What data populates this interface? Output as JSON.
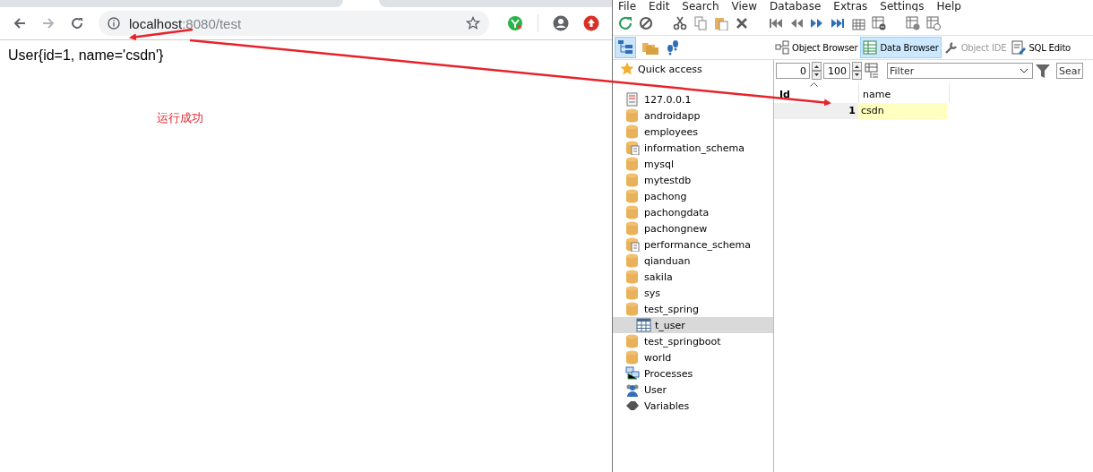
{
  "browser": {
    "url_host": "localhost",
    "url_path": ":8080/test",
    "body_text": "User{id=1, name='csdn'}",
    "note": "运行成功"
  },
  "sqlyog": {
    "menu": [
      "File",
      "Edit",
      "Search",
      "View",
      "Database",
      "Extras",
      "Settings",
      "Help"
    ],
    "view_tabs": [
      {
        "label": "Object Browser",
        "selected": false,
        "disabled": false
      },
      {
        "label": "Data Browser",
        "selected": true,
        "disabled": false
      },
      {
        "label": "Object IDE",
        "selected": false,
        "disabled": true
      },
      {
        "label": "SQL Edito",
        "selected": false,
        "disabled": false
      }
    ],
    "quick_access": "Quick access",
    "limit_start": "0",
    "limit_count": "100",
    "filter_placeholder": "Filter",
    "search_placeholder": "Sear",
    "tree": {
      "label": "127.0.0.1",
      "kind": "server",
      "children": [
        {
          "label": "androidapp",
          "kind": "db",
          "selected": false
        },
        {
          "label": "employees",
          "kind": "db",
          "selected": false
        },
        {
          "label": "information_schema",
          "kind": "sysdb",
          "selected": false
        },
        {
          "label": "mysql",
          "kind": "db",
          "selected": false
        },
        {
          "label": "mytestdb",
          "kind": "db",
          "selected": false
        },
        {
          "label": "pachong",
          "kind": "db",
          "selected": false
        },
        {
          "label": "pachongdata",
          "kind": "db",
          "selected": false
        },
        {
          "label": "pachongnew",
          "kind": "db",
          "selected": false
        },
        {
          "label": "performance_schema",
          "kind": "sysdb",
          "selected": false
        },
        {
          "label": "qianduan",
          "kind": "db",
          "selected": false
        },
        {
          "label": "sakila",
          "kind": "db",
          "selected": false
        },
        {
          "label": "sys",
          "kind": "db",
          "selected": false
        },
        {
          "label": "test_spring",
          "kind": "db",
          "selected": false,
          "children": [
            {
              "label": "t_user",
              "kind": "table",
              "selected": true
            }
          ]
        },
        {
          "label": "test_springboot",
          "kind": "db",
          "selected": false
        },
        {
          "label": "world",
          "kind": "db",
          "selected": false
        },
        {
          "label": "Processes",
          "kind": "processes",
          "selected": false
        },
        {
          "label": "User",
          "kind": "user",
          "selected": false
        },
        {
          "label": "Variables",
          "kind": "variables",
          "selected": false
        }
      ]
    },
    "grid": {
      "columns": [
        "Id",
        "name"
      ],
      "rows": [
        [
          "1",
          "csdn"
        ]
      ]
    }
  }
}
